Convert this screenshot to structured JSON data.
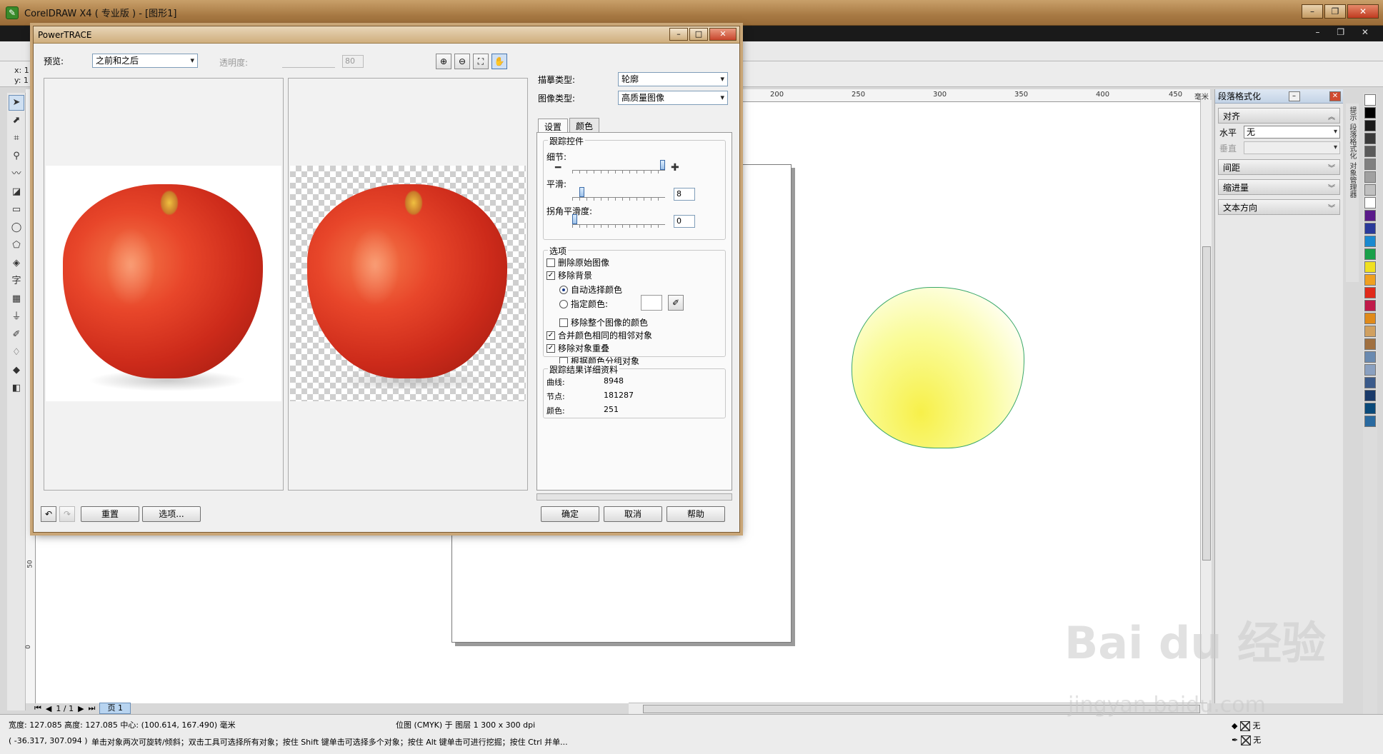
{
  "window": {
    "title": "CorelDRAW X4 ( 专业版 ) - [图形1]",
    "app_icon": "coreldraw-icon",
    "controls": [
      "–",
      "❐",
      "✕"
    ],
    "mdi_controls": "– ❐ ✕"
  },
  "coords": {
    "x_label": "x: 1",
    "y_label": "y: 1"
  },
  "toolbox": {
    "tools": [
      "pick-tool-icon",
      "shape-tool-icon",
      "crop-tool-icon",
      "zoom-tool-icon",
      "freehand-tool-icon",
      "smart-fill-icon",
      "rectangle-tool-icon",
      "ellipse-tool-icon",
      "polygon-tool-icon",
      "basic-shapes-icon",
      "text-tool-icon",
      "table-tool-icon",
      "interactive-tool-icon",
      "eyedropper-tool-icon",
      "outline-tool-icon",
      "fill-tool-icon",
      "interactive-fill-icon"
    ],
    "text_glyph": "字"
  },
  "ruler": {
    "top": [
      "200",
      "250",
      "300",
      "350",
      "400",
      "450",
      "毫米"
    ],
    "left": [
      "50",
      "0"
    ]
  },
  "page_nav": {
    "position": "1 / 1",
    "tab": "页 1"
  },
  "docker": {
    "title": "段落格式化",
    "sections": {
      "align": "对齐",
      "horizontal_label": "水平",
      "horizontal_value": "无",
      "vertical_label": "垂直",
      "spacing": "间距",
      "indent": "缩进量",
      "text_direction": "文本方向"
    },
    "vertical_tabs": [
      "提示",
      "段落格式化",
      "对象管理器"
    ]
  },
  "palette": {
    "colors": [
      "#ffffff",
      "#000000",
      "#1a1a1a",
      "#3a3a3a",
      "#5a5a5a",
      "#808080",
      "#a0a0a0",
      "#c0c0c0",
      "#ffffff",
      "#5a1a8a",
      "#2a3a9a",
      "#1a8ad0",
      "#1aa04a",
      "#f0e020",
      "#f0a020",
      "#e02a1a",
      "#c01a4a",
      "#e08a1a",
      "#d0a060",
      "#a07040",
      "#6a8ab0",
      "#8aa0c0",
      "#3a5a8a",
      "#1a3a6a",
      "#0a4a7a",
      "#2a6aa0"
    ]
  },
  "status": {
    "dimensions": "宽度: 127.085  高度: 127.085  中心: (100.614, 167.490)  毫米",
    "object": "位图 (CMYK) 于 图层 1 300 x 300 dpi",
    "cursor": "( -36.317, 307.094 )",
    "hint": "单击对象两次可旋转/倾斜；双击工具可选择所有对象；按住 Shift 键单击可选择多个对象；按住 Alt 键单击可进行挖掘；按住 Ctrl 并单...",
    "fill_label": "无",
    "outline_label": "无"
  },
  "watermark": {
    "main": "Bai du 经验",
    "sub": "jingyan.baidu.com"
  },
  "dialog": {
    "title": "PowerTRACE",
    "controls": [
      "–",
      "□",
      "✕"
    ],
    "preview_label": "预览:",
    "preview_value": "之前和之后",
    "opacity_label": "透明度:",
    "opacity_value": "80",
    "zoom_icons": [
      "zoom-in-icon",
      "zoom-out-icon",
      "zoom-fit-icon",
      "pan-hand-icon"
    ],
    "trace_type_label": "描摹类型:",
    "trace_type_value": "轮廓",
    "image_type_label": "图像类型:",
    "image_type_value": "高质量图像",
    "tabs": [
      "设置",
      "颜色"
    ],
    "trace_controls_title": "跟踪控件",
    "detail_label": "细节:",
    "detail_level": 1.0,
    "smoothing_label": "平滑:",
    "smoothing_value": "8",
    "corner_label": "拐角平滑度:",
    "corner_value": "0",
    "options_title": "选项",
    "opt_delete_original": "删除原始图像",
    "opt_remove_background": "移除背景",
    "opt_auto_color": "自动选择颜色",
    "opt_specify_color": "指定颜色:",
    "opt_remove_entire_color": "移除整个图像的颜色",
    "opt_merge_adjacent": "合并颜色相同的相邻对象",
    "opt_remove_overlap": "移除对象重叠",
    "opt_group_by_color": "根据颜色分组对象",
    "details_title": "跟踪结果详细资料",
    "curves_label": "曲线:",
    "curves_value": "8948",
    "nodes_label": "节点:",
    "nodes_value": "181287",
    "colors_label": "颜色:",
    "colors_value": "251",
    "reset_label": "重置",
    "options_label": "选项...",
    "ok_label": "确定",
    "cancel_label": "取消",
    "help_label": "帮助",
    "checked": {
      "delete_original": false,
      "remove_background": true,
      "remove_entire_color": false,
      "merge_adjacent": true,
      "remove_overlap": true,
      "group_by_color": false
    },
    "check_mark": "✓"
  }
}
